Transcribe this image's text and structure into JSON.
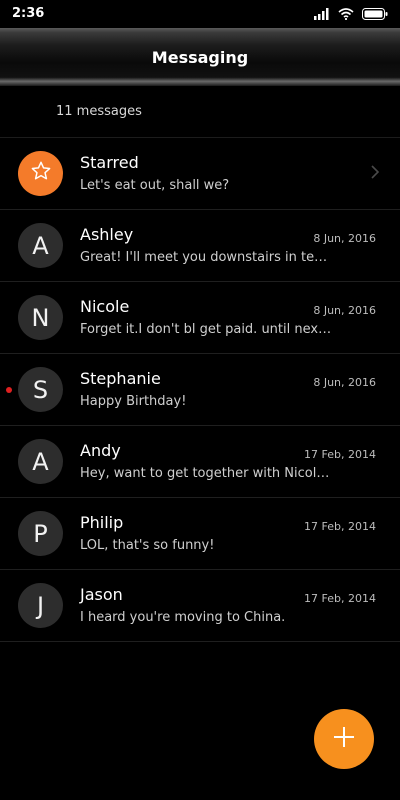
{
  "status_bar": {
    "time": "2:36"
  },
  "header": {
    "title": "Messaging"
  },
  "count_label": "11 messages",
  "conversations": [
    {
      "avatar": "star-icon",
      "name": "Starred",
      "preview": "Let's eat out, shall we?",
      "date": "",
      "unread": false,
      "starred": true
    },
    {
      "avatar": "A",
      "name": "Ashley",
      "preview": "Great! I'll meet you downstairs in ten minutes.",
      "date": "8 Jun, 2016",
      "unread": false
    },
    {
      "avatar": "N",
      "name": "Nicole",
      "preview": "Forget it.I don't bl get paid. until next Friday.",
      "date": "8 Jun, 2016",
      "unread": false
    },
    {
      "avatar": "S",
      "name": "Stephanie",
      "preview": "Happy Birthday!",
      "date": "8 Jun, 2016",
      "unread": true
    },
    {
      "avatar": "A",
      "name": "Andy",
      "preview": "Hey, want to get together with Nicole on Saturday?",
      "date": "17 Feb, 2014",
      "unread": false
    },
    {
      "avatar": "P",
      "name": "Philip",
      "preview": "LOL, that's so funny!",
      "date": "17 Feb, 2014",
      "unread": false
    },
    {
      "avatar": "J",
      "name": "Jason",
      "preview": "I heard you're moving to China.",
      "date": "17 Feb, 2014",
      "unread": false
    }
  ],
  "colors": {
    "accent": "#f7901e",
    "starred_avatar": "#f47b2a",
    "unread_dot": "#e02020"
  },
  "icons": {
    "status": [
      "signal-icon",
      "wifi-icon",
      "battery-icon"
    ],
    "fab": "plus-icon",
    "starred_chevron": "chevron-right-icon"
  }
}
